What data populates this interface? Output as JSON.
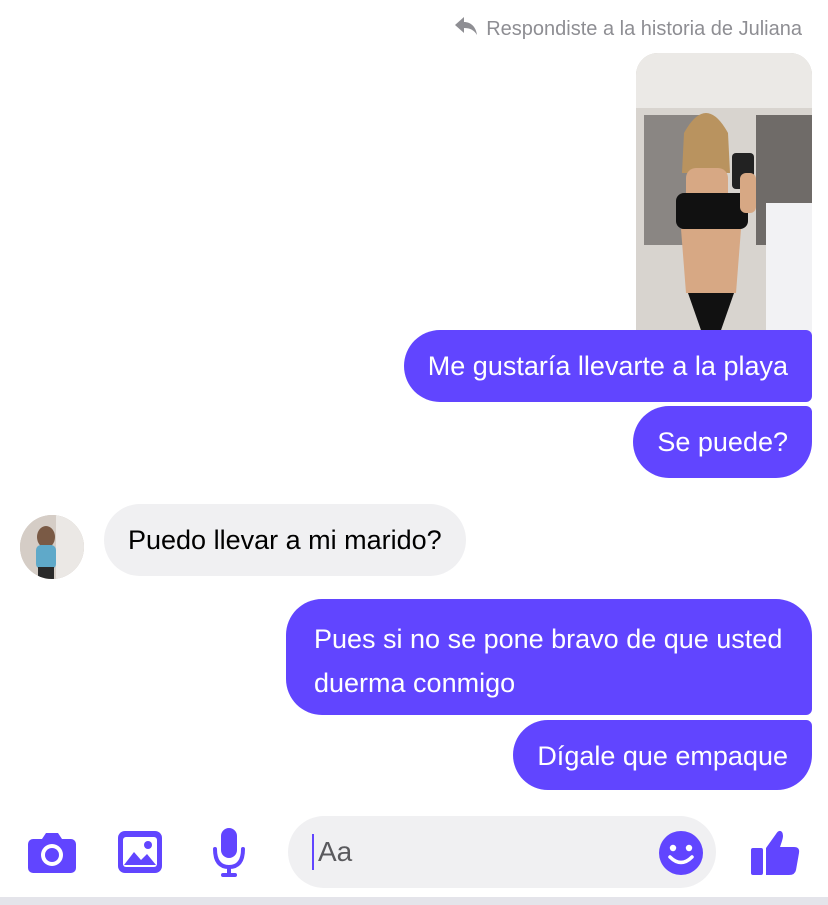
{
  "reply_note": {
    "text": "Respondiste a la historia de Juliana",
    "icon": "reply-arrow-icon"
  },
  "story": {
    "alt": "story-thumbnail"
  },
  "messages": [
    {
      "side": "out",
      "text": "Me gustaría llevarte a la playa"
    },
    {
      "side": "out",
      "text": "Se puede?"
    },
    {
      "side": "in",
      "text": "Puedo llevar a mi marido?"
    },
    {
      "side": "out",
      "text": "Pues si no se pone bravo de que usted duerma conmigo"
    },
    {
      "side": "out",
      "text": "Dígale que empaque"
    }
  ],
  "composer": {
    "placeholder": "Aa",
    "icons": [
      "camera-icon",
      "gallery-icon",
      "microphone-icon",
      "emoji-icon",
      "thumbs-up-icon"
    ]
  },
  "colors": {
    "accent": "#6145ff",
    "incoming": "#f0f0f2",
    "meta": "#8e8e93"
  }
}
